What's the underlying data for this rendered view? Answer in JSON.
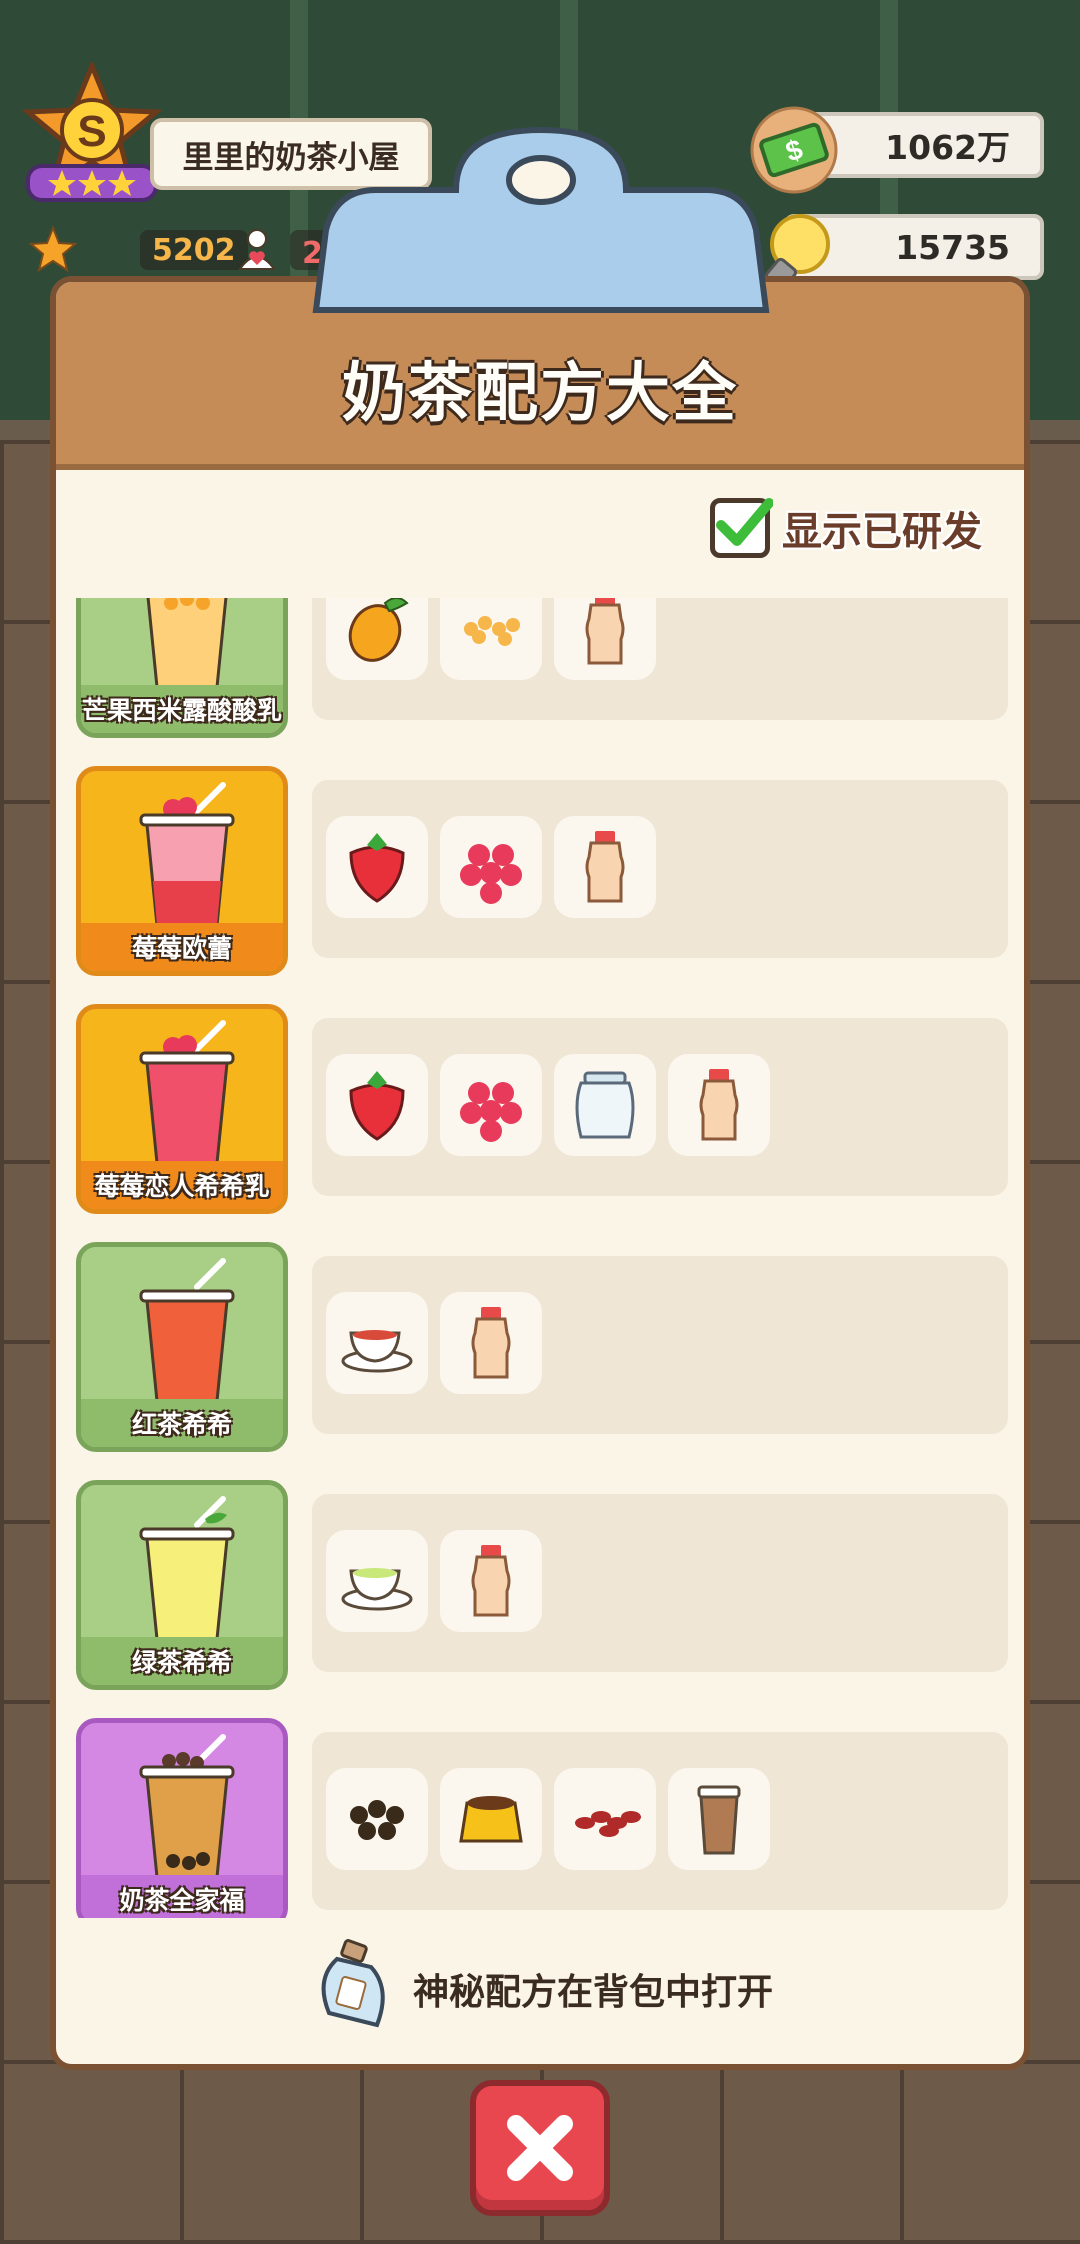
{
  "hud": {
    "rank_letter": "S",
    "shop_name": "里里的奶茶小屋",
    "stars_count": "5202",
    "fans_count": "283.0万",
    "money": "1062万",
    "ideas": "15735"
  },
  "panel": {
    "title": "奶茶配方大全",
    "toggle_label": "显示已研发",
    "toggle_checked": true,
    "footer_text": "神秘配方在背包中打开"
  },
  "recipes": [
    {
      "name": "芒果西米露酸酸乳",
      "card_color": "green",
      "ingredients": [
        "mango-icon",
        "sago-icon",
        "yogurt-bottle-icon"
      ]
    },
    {
      "name": "莓莓欧蕾",
      "card_color": "orange",
      "ingredients": [
        "strawberry-icon",
        "raspberry-icon",
        "yogurt-bottle-icon"
      ]
    },
    {
      "name": "莓莓恋人希希乳",
      "card_color": "orange",
      "ingredients": [
        "strawberry-icon",
        "raspberry-icon",
        "milk-jar-icon",
        "yogurt-bottle-icon"
      ]
    },
    {
      "name": "红茶希希",
      "card_color": "green",
      "ingredients": [
        "black-tea-cup-icon",
        "yogurt-bottle-icon"
      ]
    },
    {
      "name": "绿茶希希",
      "card_color": "green",
      "ingredients": [
        "green-tea-cup-icon",
        "yogurt-bottle-icon"
      ]
    },
    {
      "name": "奶茶全家福",
      "card_color": "purple",
      "ingredients": [
        "tapioca-pearls-icon",
        "pudding-icon",
        "red-beans-icon",
        "milk-tea-cup-icon"
      ]
    }
  ],
  "colors": {
    "card_green": "#a9cf86",
    "card_orange": "#f7b51c",
    "card_purple": "#d488e3",
    "header_brown": "#c68c58",
    "close_red": "#e8474f"
  }
}
